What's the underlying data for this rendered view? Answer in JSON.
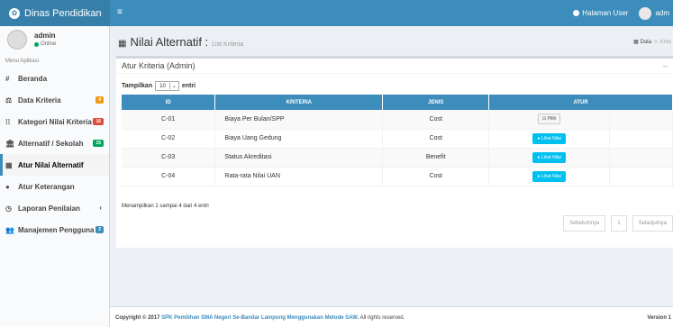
{
  "header": {
    "brand": "Dinas Pendidikan",
    "hamburger": "≡",
    "home_link": "Halaman User",
    "user": "adm"
  },
  "sidebar": {
    "user_name": "admin",
    "status": "Online",
    "menu_header": "Menu Aplikasi",
    "items": [
      {
        "label": "Beranda",
        "icon": "#",
        "badge": "",
        "chev": ""
      },
      {
        "label": "Data Kriteria",
        "icon": "⚖",
        "badge": "4",
        "badge_color": "#f39c12",
        "chev": ""
      },
      {
        "label": "Kategori Nilai Kriteria",
        "icon": "⁞⁞",
        "badge": "16",
        "badge_color": "#dd4b39",
        "chev": ""
      },
      {
        "label": "Alternatif / Sekolah",
        "icon": "🏛",
        "badge": "15",
        "badge_color": "#00a65a",
        "chev": ""
      },
      {
        "label": "Atur Nilai Alternatif",
        "icon": "▦",
        "badge": "",
        "chev": ""
      },
      {
        "label": "Atur Keterangan",
        "icon": "●",
        "badge": "",
        "chev": ""
      },
      {
        "label": "Laporan Penilaian",
        "icon": "◷",
        "badge": "",
        "chev": "‹"
      },
      {
        "label": "Manajemen Pengguna",
        "icon": "👥",
        "badge": "2",
        "badge_color": "#3c8dbc",
        "chev": ""
      }
    ]
  },
  "content": {
    "title": "Nilai Alternatif :",
    "subtitle": "List Kriteria",
    "breadcrumb_home": "Data",
    "breadcrumb_current": "Krite"
  },
  "box": {
    "title": "Atur Kriteria (Admin)",
    "tool": "–",
    "show_label": "Tampilkan",
    "show_value": "10",
    "entries_label": "entri",
    "columns": [
      "ID",
      "KRITERIA",
      "JENIS",
      "ATUR"
    ],
    "rows": [
      {
        "id": "C-01",
        "kriteria": "Biaya Per Bulan/SPP",
        "jenis": "Cost",
        "action": "Pilih",
        "action_type": "pilih"
      },
      {
        "id": "C-02",
        "kriteria": "Biaya Uang Gedung",
        "jenis": "Cost",
        "action": "Lihat Nilai",
        "action_type": "lihat"
      },
      {
        "id": "C-03",
        "kriteria": "Status Akreditasi",
        "jenis": "Benefit",
        "action": "Lihat Nilai",
        "action_type": "lihat"
      },
      {
        "id": "C-04",
        "kriteria": "Rata-rata Nilai UAN",
        "jenis": "Cost",
        "action": "Lihat Nilai",
        "action_type": "lihat"
      }
    ],
    "info": "Menampilkan 1 sampai 4 dari 4 entri",
    "prev": "Sebelumnya",
    "page": "1",
    "next": "Selanjutnya"
  },
  "footer": {
    "copyright": "Copyright © 2017",
    "app_name": "SPK Pemilihan SMA Negeri Se-Bandar Lampung Menggunakan Metode SAW.",
    "rights": "All rights reserved.",
    "version": "Version 1"
  }
}
